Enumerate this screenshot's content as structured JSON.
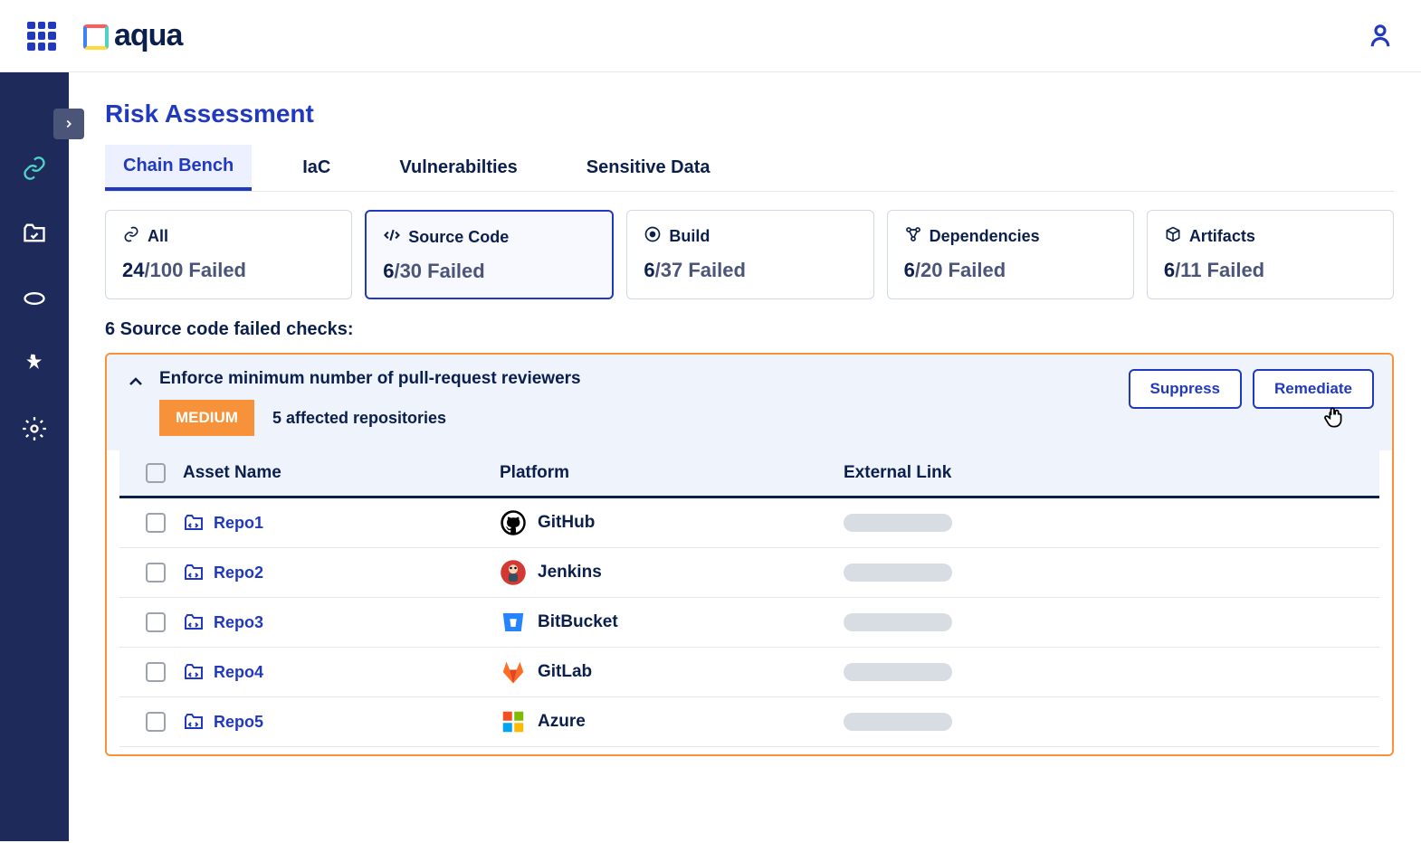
{
  "header": {
    "brand": "aqua"
  },
  "page": {
    "title": "Risk Assessment"
  },
  "tabs": [
    {
      "label": "Chain Bench",
      "active": true
    },
    {
      "label": "IaC",
      "active": false
    },
    {
      "label": "Vulnerabilties",
      "active": false
    },
    {
      "label": "Sensitive Data",
      "active": false
    }
  ],
  "summary": [
    {
      "icon": "link",
      "label": "All",
      "failed": "24",
      "total": "/100 Failed",
      "active": false
    },
    {
      "icon": "code",
      "label": "Source Code",
      "failed": "6",
      "total": "/30 Failed",
      "active": true
    },
    {
      "icon": "build",
      "label": "Build",
      "failed": "6",
      "total": "/37 Failed",
      "active": false
    },
    {
      "icon": "deps",
      "label": "Dependencies",
      "failed": "6",
      "total": "/20 Failed",
      "active": false
    },
    {
      "icon": "artifacts",
      "label": "Artifacts",
      "failed": "6",
      "total": "/11 Failed",
      "active": false
    }
  ],
  "section_heading": "6 Source code failed checks:",
  "check": {
    "title": "Enforce minimum number of pull-request reviewers",
    "severity": "MEDIUM",
    "affected": "5 affected repositories",
    "suppress_label": "Suppress",
    "remediate_label": "Remediate"
  },
  "table": {
    "headers": {
      "asset": "Asset Name",
      "platform": "Platform",
      "link": "External Link"
    },
    "rows": [
      {
        "asset": "Repo1",
        "platform": "GitHub",
        "platform_key": "github"
      },
      {
        "asset": "Repo2",
        "platform": "Jenkins",
        "platform_key": "jenkins"
      },
      {
        "asset": "Repo3",
        "platform": "BitBucket",
        "platform_key": "bitbucket"
      },
      {
        "asset": "Repo4",
        "platform": "GitLab",
        "platform_key": "gitlab"
      },
      {
        "asset": "Repo5",
        "platform": "Azure",
        "platform_key": "azure"
      }
    ]
  }
}
